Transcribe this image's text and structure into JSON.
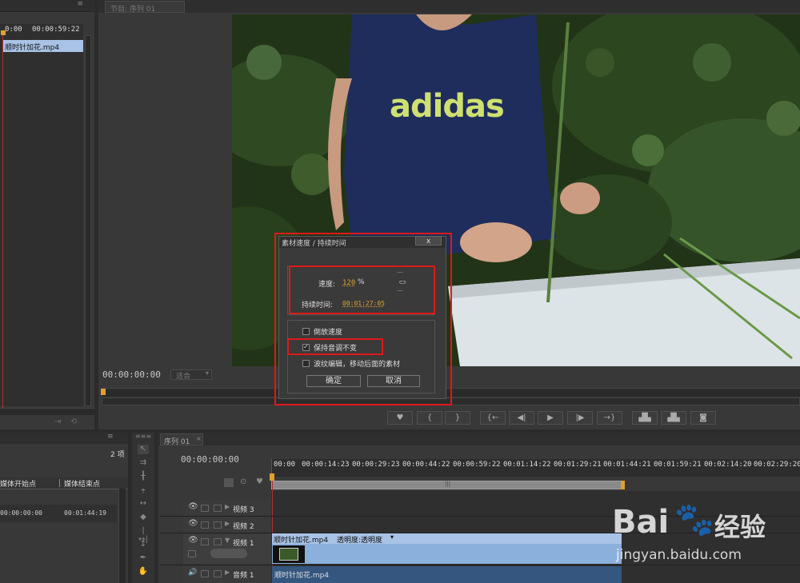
{
  "project_panel": {
    "timecode_start": "0:00",
    "timecode_end": "00:00:59:22",
    "clip_name": "顺时针加花.mp4"
  },
  "monitor": {
    "tab_label": "节目: 序列 01",
    "timecode": "00:00:00:00",
    "fit_label": "适合",
    "shirt_text": "adidas"
  },
  "dialog": {
    "title": "素材速度 / 持续时间",
    "speed_label": "速度:",
    "speed_value": "120",
    "speed_unit": "%",
    "duration_label": "持续时间:",
    "duration_value": "00:01:27:05",
    "reverse_label": "倒放速度",
    "reverse_checked": false,
    "keep_pitch_label": "保持音调不变",
    "keep_pitch_checked": true,
    "ripple_label": "波纹编辑，移动后面的素材",
    "ripple_checked": false,
    "ok_label": "确定",
    "cancel_label": "取消",
    "close_glyph": "x",
    "link_glyph": "⊂⊃"
  },
  "media_panel": {
    "count": "2 项",
    "col_in": "媒体开始点",
    "col_out": "媒体结束点",
    "row_in": "00:00:00:00",
    "row_out": "00:01:44:19"
  },
  "timeline": {
    "tab_label": "序列 01",
    "timecode": "00:00:00:00",
    "ruler": [
      "00:00",
      "00:00:14:23",
      "00:00:29:23",
      "00:00:44:22",
      "00:00:59:22",
      "00:01:14:22",
      "00:01:29:21",
      "00:01:44:21",
      "00:01:59:21",
      "00:02:14:20",
      "00:02:29:20"
    ],
    "tracks": {
      "v3": "视频 3",
      "v2": "视频 2",
      "v1": "视频 1",
      "a1": "音频 1"
    },
    "video_clip_label": "顺时针加花.mp4",
    "opacity_label": "透明度:透明度",
    "audio_clip_label": "顺时针加花.mp4"
  },
  "watermark": {
    "brand": "Bai",
    "brand_cn": "经验",
    "url": "jingyan.baidu.com"
  },
  "colors": {
    "highlight_red": "#e01818",
    "clip_blue": "#8cb0dc",
    "audio_blue": "#34567f",
    "timecode_orange": "#e0a030"
  }
}
